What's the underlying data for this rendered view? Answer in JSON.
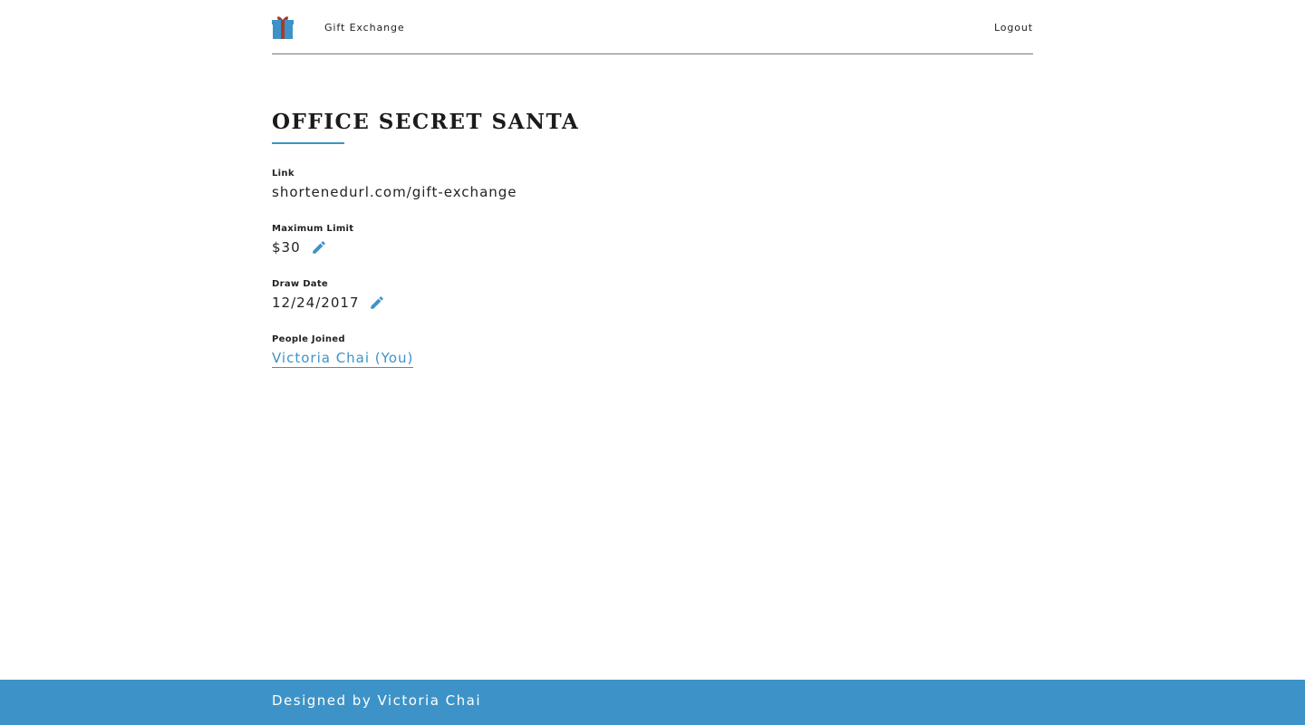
{
  "header": {
    "brand": "Gift Exchange",
    "logout_label": "Logout",
    "logo_icon": "gift-icon"
  },
  "exchange": {
    "title": "OFFICE SECRET SANTA",
    "fields": {
      "link": {
        "label": "Link",
        "value": "shortenedurl.com/gift-exchange"
      },
      "max_limit": {
        "label": "Maximum Limit",
        "value": "$30",
        "icon": "pencil-icon"
      },
      "draw_date": {
        "label": "Draw Date",
        "value": "12/24/2017",
        "icon": "pencil-icon"
      },
      "people_joined": {
        "label": "People Joined",
        "people": [
          "Victoria Chai (You)"
        ]
      }
    }
  },
  "footer": {
    "text": "Designed by Victoria Chai"
  },
  "colors": {
    "accent": "#3d93c7",
    "gift_box": "#3d93c7",
    "gift_ribbon": "#a83a32",
    "text": "#222222"
  }
}
